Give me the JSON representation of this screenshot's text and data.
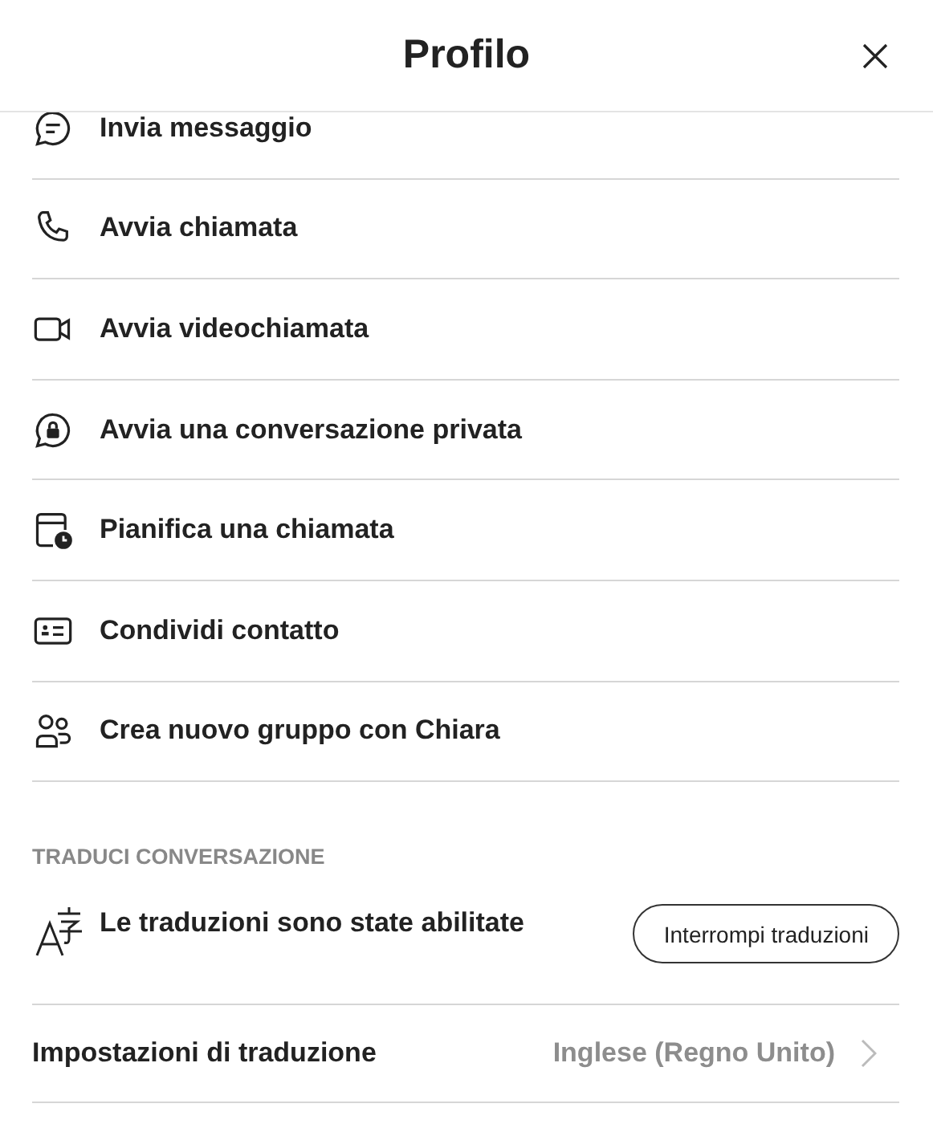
{
  "header": {
    "title": "Profilo"
  },
  "actions": [
    {
      "kind": "message",
      "label": "Invia messaggio"
    },
    {
      "kind": "call",
      "label": "Avvia chiamata"
    },
    {
      "kind": "video",
      "label": "Avvia videochiamata"
    },
    {
      "kind": "private",
      "label": "Avvia una conversazione privata"
    },
    {
      "kind": "schedule",
      "label": "Pianifica una chiamata"
    },
    {
      "kind": "contact",
      "label": "Condividi contatto"
    },
    {
      "kind": "group",
      "label": "Crea nuovo gruppo con Chiara"
    }
  ],
  "translate": {
    "heading": "TRADUCI CONVERSAZIONE",
    "status": "Le traduzioni sono state abilitate",
    "button": "Interrompi traduzioni",
    "settings_label": "Impostazioni di traduzione",
    "settings_value": "Inglese (Regno Unito)"
  }
}
